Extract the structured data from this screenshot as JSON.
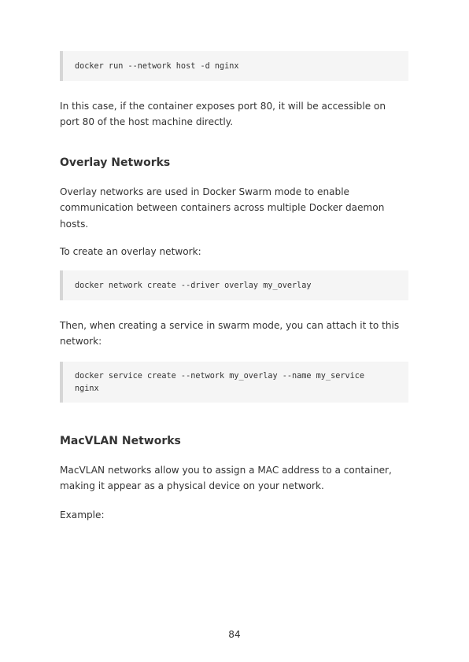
{
  "code_blocks": [
    "docker run --network host -d nginx",
    "docker network create --driver overlay my_overlay",
    "docker service create --network my_overlay --name my_service\nnginx"
  ],
  "paragraphs": [
    "In this case, if the container exposes port 80, it will be accessible on port 80 of the host machine directly.",
    "Overlay networks are used in Docker Swarm mode to enable communication between containers across multiple Docker daemon hosts.",
    "To create an overlay network:",
    "Then, when creating a service in swarm mode, you can attach it to this network:",
    "MacVLAN networks allow you to assign a MAC address to a container, making it appear as a physical device on your network.",
    "Example:"
  ],
  "headings": [
    "Overlay Networks",
    "MacVLAN Networks"
  ],
  "page_number": "84"
}
